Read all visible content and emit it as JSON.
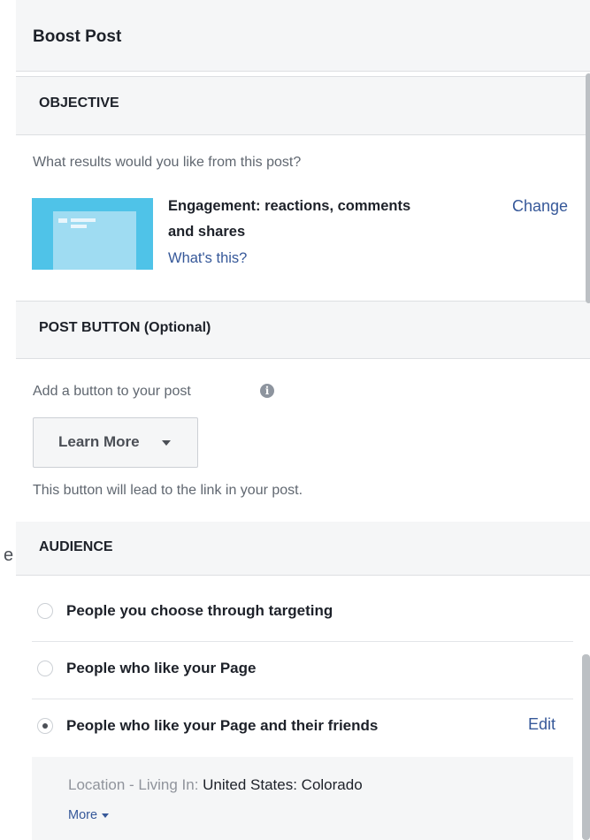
{
  "ghost_text": "e",
  "header": {
    "title": "Boost Post"
  },
  "objective": {
    "section_label": "OBJECTIVE",
    "question": "What results would you like from this post?",
    "selected_line1": "Engagement: reactions, comments",
    "selected_line2": "and shares",
    "whats_this": "What's this?",
    "change": "Change"
  },
  "post_button": {
    "section_label": "POST BUTTON (Optional)",
    "add_label": "Add a button to your post",
    "info_icon": "info-icon",
    "dropdown_value": "Learn More",
    "hint": "This button will lead to the link in your post."
  },
  "audience": {
    "section_label": "AUDIENCE",
    "options": [
      {
        "label": "People you choose through targeting",
        "selected": false
      },
      {
        "label": "People who like your Page",
        "selected": false
      },
      {
        "label": "People who like your Page and their friends",
        "selected": true
      }
    ],
    "edit": "Edit",
    "location_label": "Location - Living In:",
    "location_value": "United States: Colorado",
    "more": "More"
  },
  "colors": {
    "link": "#365899",
    "section_bg": "#f5f6f7",
    "thumbnail": "#4fc3e8"
  }
}
